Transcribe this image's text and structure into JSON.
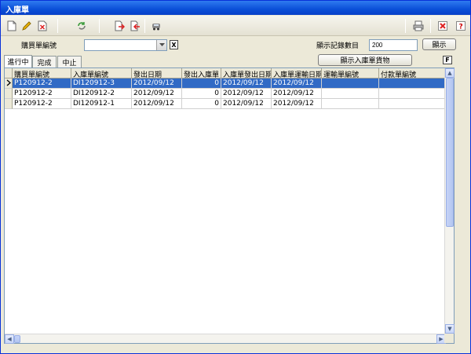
{
  "window": {
    "title": "入庫單"
  },
  "filter": {
    "purchase_no_label": "購買單編號",
    "purchase_no_value": "",
    "record_count_label": "顯示記錄數目",
    "record_count_value": "200",
    "show_button": "顯示",
    "show_goods_button": "顯示入庫單貨物",
    "clear_icon_text": "X",
    "filter_icon_text": "F"
  },
  "tabs": [
    {
      "label": "進行中",
      "active": true
    },
    {
      "label": "完成",
      "active": false
    },
    {
      "label": "中止",
      "active": false
    }
  ],
  "grid": {
    "columns": [
      "購買單編號",
      "入庫單編號",
      "發出日期",
      "發出入庫單",
      "入庫單發出日期",
      "入庫單運輸日期",
      "運輸單編號",
      "付款單編號"
    ],
    "rows": [
      {
        "purchase_no": "P120912-2",
        "inbound_no": "DI120912-3",
        "issue_date": "2012/09/12",
        "issued_count": "0",
        "inbound_issue_date": "2012/09/12",
        "inbound_ship_date": "2012/09/12",
        "ship_no": "",
        "payment_no": "",
        "selected": true
      },
      {
        "purchase_no": "P120912-2",
        "inbound_no": "DI120912-2",
        "issue_date": "2012/09/12",
        "issued_count": "0",
        "inbound_issue_date": "2012/09/12",
        "inbound_ship_date": "2012/09/12",
        "ship_no": "",
        "payment_no": "",
        "selected": false
      },
      {
        "purchase_no": "P120912-2",
        "inbound_no": "DI120912-1",
        "issue_date": "2012/09/12",
        "issued_count": "0",
        "inbound_issue_date": "2012/09/12",
        "inbound_ship_date": "2012/09/12",
        "ship_no": "",
        "payment_no": "",
        "selected": false
      }
    ]
  },
  "colors": {
    "selection": "#316ac5",
    "titlebar": "#0a4fd8",
    "window_bg": "#ece9d8"
  },
  "icons": [
    "new-icon",
    "edit-icon",
    "delete-icon",
    "refresh-icon",
    "export-icon",
    "import-icon",
    "vehicle-icon",
    "print-icon",
    "close-icon",
    "help-icon"
  ]
}
